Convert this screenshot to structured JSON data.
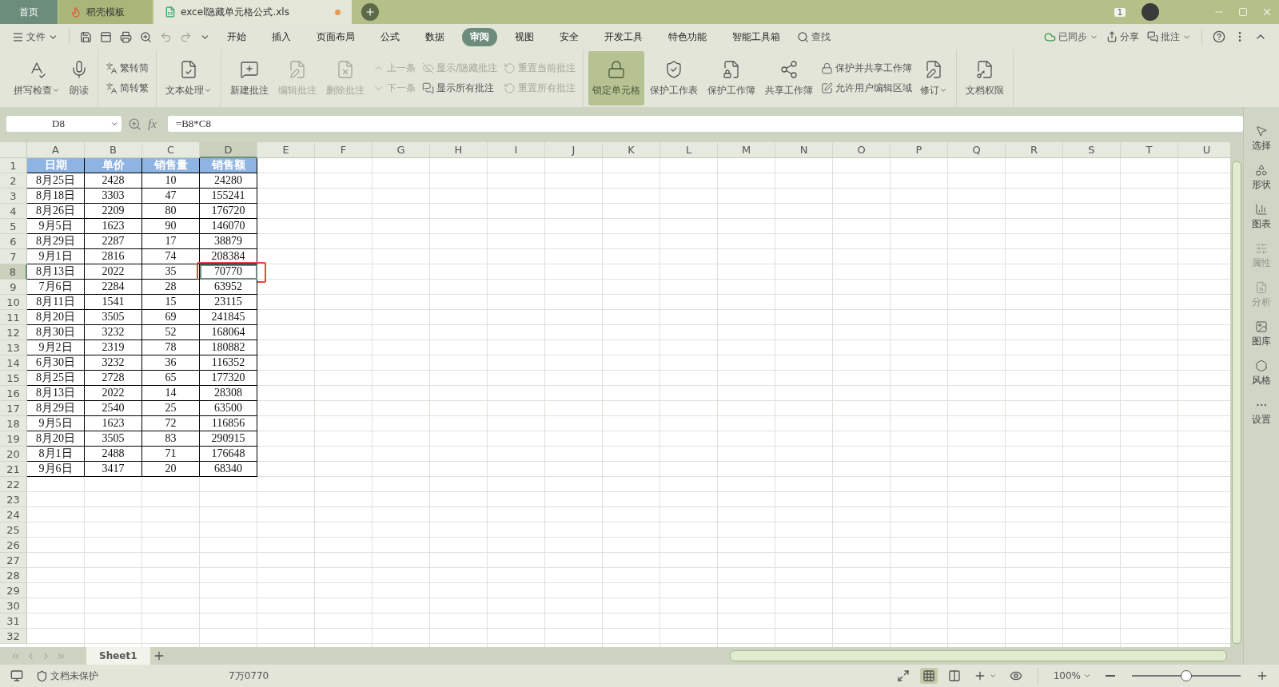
{
  "tabs": [
    {
      "label": "首页",
      "kind": "home",
      "selected": false
    },
    {
      "label": "稻壳模板",
      "kind": "template",
      "selected": false
    },
    {
      "label": "excel隐藏单元格公式.xls",
      "kind": "file",
      "selected": true,
      "modified": true
    }
  ],
  "title_bar": {
    "badge": "1"
  },
  "menu": {
    "file": "文件",
    "items": [
      {
        "label": "开始",
        "selected": false
      },
      {
        "label": "插入",
        "selected": false
      },
      {
        "label": "页面布局",
        "selected": false
      },
      {
        "label": "公式",
        "selected": false
      },
      {
        "label": "数据",
        "selected": false
      },
      {
        "label": "审阅",
        "selected": true
      },
      {
        "label": "视图",
        "selected": false
      },
      {
        "label": "安全",
        "selected": false
      },
      {
        "label": "开发工具",
        "selected": false
      },
      {
        "label": "特色功能",
        "selected": false
      },
      {
        "label": "智能工具箱",
        "selected": false
      }
    ],
    "search": "查找",
    "sync": "已同步",
    "share": "分享",
    "comment": "批注"
  },
  "ribbon": [
    [
      {
        "kind": "large",
        "label": "拼写检查",
        "dropdown": true,
        "disabled": false,
        "active": false
      },
      {
        "kind": "large",
        "label": "朗读",
        "dropdown": false,
        "disabled": false,
        "active": false
      }
    ],
    [
      {
        "kind": "stack",
        "items": [
          {
            "label": "繁转简",
            "disabled": false
          },
          {
            "label": "简转繁",
            "disabled": false
          }
        ]
      }
    ],
    [
      {
        "kind": "large",
        "label": "文本处理",
        "dropdown": true,
        "disabled": false,
        "active": false
      }
    ],
    [
      {
        "kind": "large",
        "label": "新建批注",
        "dropdown": false,
        "disabled": false,
        "active": false
      },
      {
        "kind": "large",
        "label": "编辑批注",
        "dropdown": false,
        "disabled": true,
        "active": false
      },
      {
        "kind": "large",
        "label": "删除批注",
        "dropdown": false,
        "disabled": true,
        "active": false
      },
      {
        "kind": "stack",
        "items": [
          {
            "label": "上一条",
            "disabled": true
          },
          {
            "label": "下一条",
            "disabled": true
          }
        ]
      },
      {
        "kind": "stack",
        "items": [
          {
            "label": "显示/隐藏批注",
            "disabled": true
          },
          {
            "label": "显示所有批注",
            "disabled": false
          }
        ]
      },
      {
        "kind": "stack",
        "items": [
          {
            "label": "重置当前批注",
            "disabled": true
          },
          {
            "label": "重置所有批注",
            "disabled": true
          }
        ]
      }
    ],
    [
      {
        "kind": "large",
        "label": "锁定单元格",
        "dropdown": false,
        "disabled": false,
        "active": true
      },
      {
        "kind": "large",
        "label": "保护工作表",
        "dropdown": false,
        "disabled": false,
        "active": false
      },
      {
        "kind": "large",
        "label": "保护工作簿",
        "dropdown": false,
        "disabled": false,
        "active": false
      },
      {
        "kind": "large",
        "label": "共享工作簿",
        "dropdown": false,
        "disabled": false,
        "active": false
      },
      {
        "kind": "stack",
        "items": [
          {
            "label": "保护并共享工作簿",
            "disabled": false
          },
          {
            "label": "允许用户编辑区域",
            "disabled": false
          }
        ]
      },
      {
        "kind": "large",
        "label": "修订",
        "dropdown": true,
        "disabled": false,
        "active": false
      }
    ],
    [
      {
        "kind": "large",
        "label": "文档权限",
        "dropdown": false,
        "disabled": false,
        "active": false
      }
    ]
  ],
  "formula_bar": {
    "name_box": "D8",
    "fx": "fx",
    "formula": "=B8*C8"
  },
  "sheet": {
    "highlight_selection": true,
    "columns": [
      {
        "label": "A",
        "selected": false
      },
      {
        "label": "B",
        "selected": false
      },
      {
        "label": "C",
        "selected": false
      },
      {
        "label": "D",
        "selected": true
      },
      {
        "label": "E",
        "selected": false
      },
      {
        "label": "F",
        "selected": false
      },
      {
        "label": "G",
        "selected": false
      },
      {
        "label": "H",
        "selected": false
      },
      {
        "label": "I",
        "selected": false
      },
      {
        "label": "J",
        "selected": false
      },
      {
        "label": "K",
        "selected": false
      },
      {
        "label": "L",
        "selected": false
      },
      {
        "label": "M",
        "selected": false
      },
      {
        "label": "N",
        "selected": false
      },
      {
        "label": "O",
        "selected": false
      },
      {
        "label": "P",
        "selected": false
      },
      {
        "label": "Q",
        "selected": false
      },
      {
        "label": "R",
        "selected": false
      },
      {
        "label": "S",
        "selected": false
      },
      {
        "label": "T",
        "selected": false
      },
      {
        "label": "U",
        "selected": false
      }
    ],
    "rows": [
      {
        "header": "1",
        "selected": false,
        "kind": "heading",
        "cells": [
          "日期",
          "单价",
          "销售量",
          "销售额"
        ]
      },
      {
        "header": "2",
        "selected": false,
        "kind": "data",
        "cells": [
          "8月25日",
          "2428",
          "10",
          "24280"
        ]
      },
      {
        "header": "3",
        "selected": false,
        "kind": "data",
        "cells": [
          "8月18日",
          "3303",
          "47",
          "155241"
        ]
      },
      {
        "header": "4",
        "selected": false,
        "kind": "data",
        "cells": [
          "8月26日",
          "2209",
          "80",
          "176720"
        ]
      },
      {
        "header": "5",
        "selected": false,
        "kind": "data",
        "cells": [
          "9月5日",
          "1623",
          "90",
          "146070"
        ]
      },
      {
        "header": "6",
        "selected": false,
        "kind": "data",
        "cells": [
          "8月29日",
          "2287",
          "17",
          "38879"
        ]
      },
      {
        "header": "7",
        "selected": false,
        "kind": "data",
        "cells": [
          "9月1日",
          "2816",
          "74",
          "208384"
        ]
      },
      {
        "header": "8",
        "selected": true,
        "kind": "data",
        "cells": [
          "8月13日",
          "2022",
          "35",
          "70770"
        ]
      },
      {
        "header": "9",
        "selected": false,
        "kind": "data",
        "cells": [
          "7月6日",
          "2284",
          "28",
          "63952"
        ]
      },
      {
        "header": "10",
        "selected": false,
        "kind": "data",
        "cells": [
          "8月11日",
          "1541",
          "15",
          "23115"
        ]
      },
      {
        "header": "11",
        "selected": false,
        "kind": "data",
        "cells": [
          "8月20日",
          "3505",
          "69",
          "241845"
        ]
      },
      {
        "header": "12",
        "selected": false,
        "kind": "data",
        "cells": [
          "8月30日",
          "3232",
          "52",
          "168064"
        ]
      },
      {
        "header": "13",
        "selected": false,
        "kind": "data",
        "cells": [
          "9月2日",
          "2319",
          "78",
          "180882"
        ]
      },
      {
        "header": "14",
        "selected": false,
        "kind": "data",
        "cells": [
          "6月30日",
          "3232",
          "36",
          "116352"
        ]
      },
      {
        "header": "15",
        "selected": false,
        "kind": "data",
        "cells": [
          "8月25日",
          "2728",
          "65",
          "177320"
        ]
      },
      {
        "header": "16",
        "selected": false,
        "kind": "data",
        "cells": [
          "8月13日",
          "2022",
          "14",
          "28308"
        ]
      },
      {
        "header": "17",
        "selected": false,
        "kind": "data",
        "cells": [
          "8月29日",
          "2540",
          "25",
          "63500"
        ]
      },
      {
        "header": "18",
        "selected": false,
        "kind": "data",
        "cells": [
          "9月5日",
          "1623",
          "72",
          "116856"
        ]
      },
      {
        "header": "19",
        "selected": false,
        "kind": "data",
        "cells": [
          "8月20日",
          "3505",
          "83",
          "290915"
        ]
      },
      {
        "header": "20",
        "selected": false,
        "kind": "data",
        "cells": [
          "8月1日",
          "2488",
          "71",
          "176648"
        ]
      },
      {
        "header": "21",
        "selected": false,
        "kind": "data",
        "cells": [
          "9月6日",
          "3417",
          "20",
          "68340"
        ]
      },
      {
        "header": "22",
        "selected": false,
        "kind": "empty",
        "cells": []
      },
      {
        "header": "23",
        "selected": false,
        "kind": "empty",
        "cells": []
      },
      {
        "header": "24",
        "selected": false,
        "kind": "empty",
        "cells": []
      },
      {
        "header": "25",
        "selected": false,
        "kind": "empty",
        "cells": []
      },
      {
        "header": "26",
        "selected": false,
        "kind": "empty",
        "cells": []
      },
      {
        "header": "27",
        "selected": false,
        "kind": "empty",
        "cells": []
      },
      {
        "header": "28",
        "selected": false,
        "kind": "empty",
        "cells": []
      },
      {
        "header": "29",
        "selected": false,
        "kind": "empty",
        "cells": []
      },
      {
        "header": "30",
        "selected": false,
        "kind": "empty",
        "cells": []
      },
      {
        "header": "31",
        "selected": false,
        "kind": "empty",
        "cells": []
      },
      {
        "header": "32",
        "selected": false,
        "kind": "empty",
        "cells": []
      }
    ]
  },
  "side_panel": [
    {
      "label": "选择",
      "disabled": false
    },
    {
      "label": "形状",
      "disabled": false
    },
    {
      "label": "图表",
      "disabled": false
    },
    {
      "label": "属性",
      "disabled": true
    },
    {
      "label": "分析",
      "disabled": true
    },
    {
      "label": "图库",
      "disabled": false
    },
    {
      "label": "风格",
      "disabled": false
    },
    {
      "label": "设置",
      "disabled": false
    }
  ],
  "sheet_tabs": [
    {
      "label": "Sheet1",
      "selected": true
    }
  ],
  "status_bar": {
    "protection": "文档未保护",
    "value": "7万0770",
    "zoom": "100%",
    "zoom_level": {
      "level": 0.5
    }
  }
}
